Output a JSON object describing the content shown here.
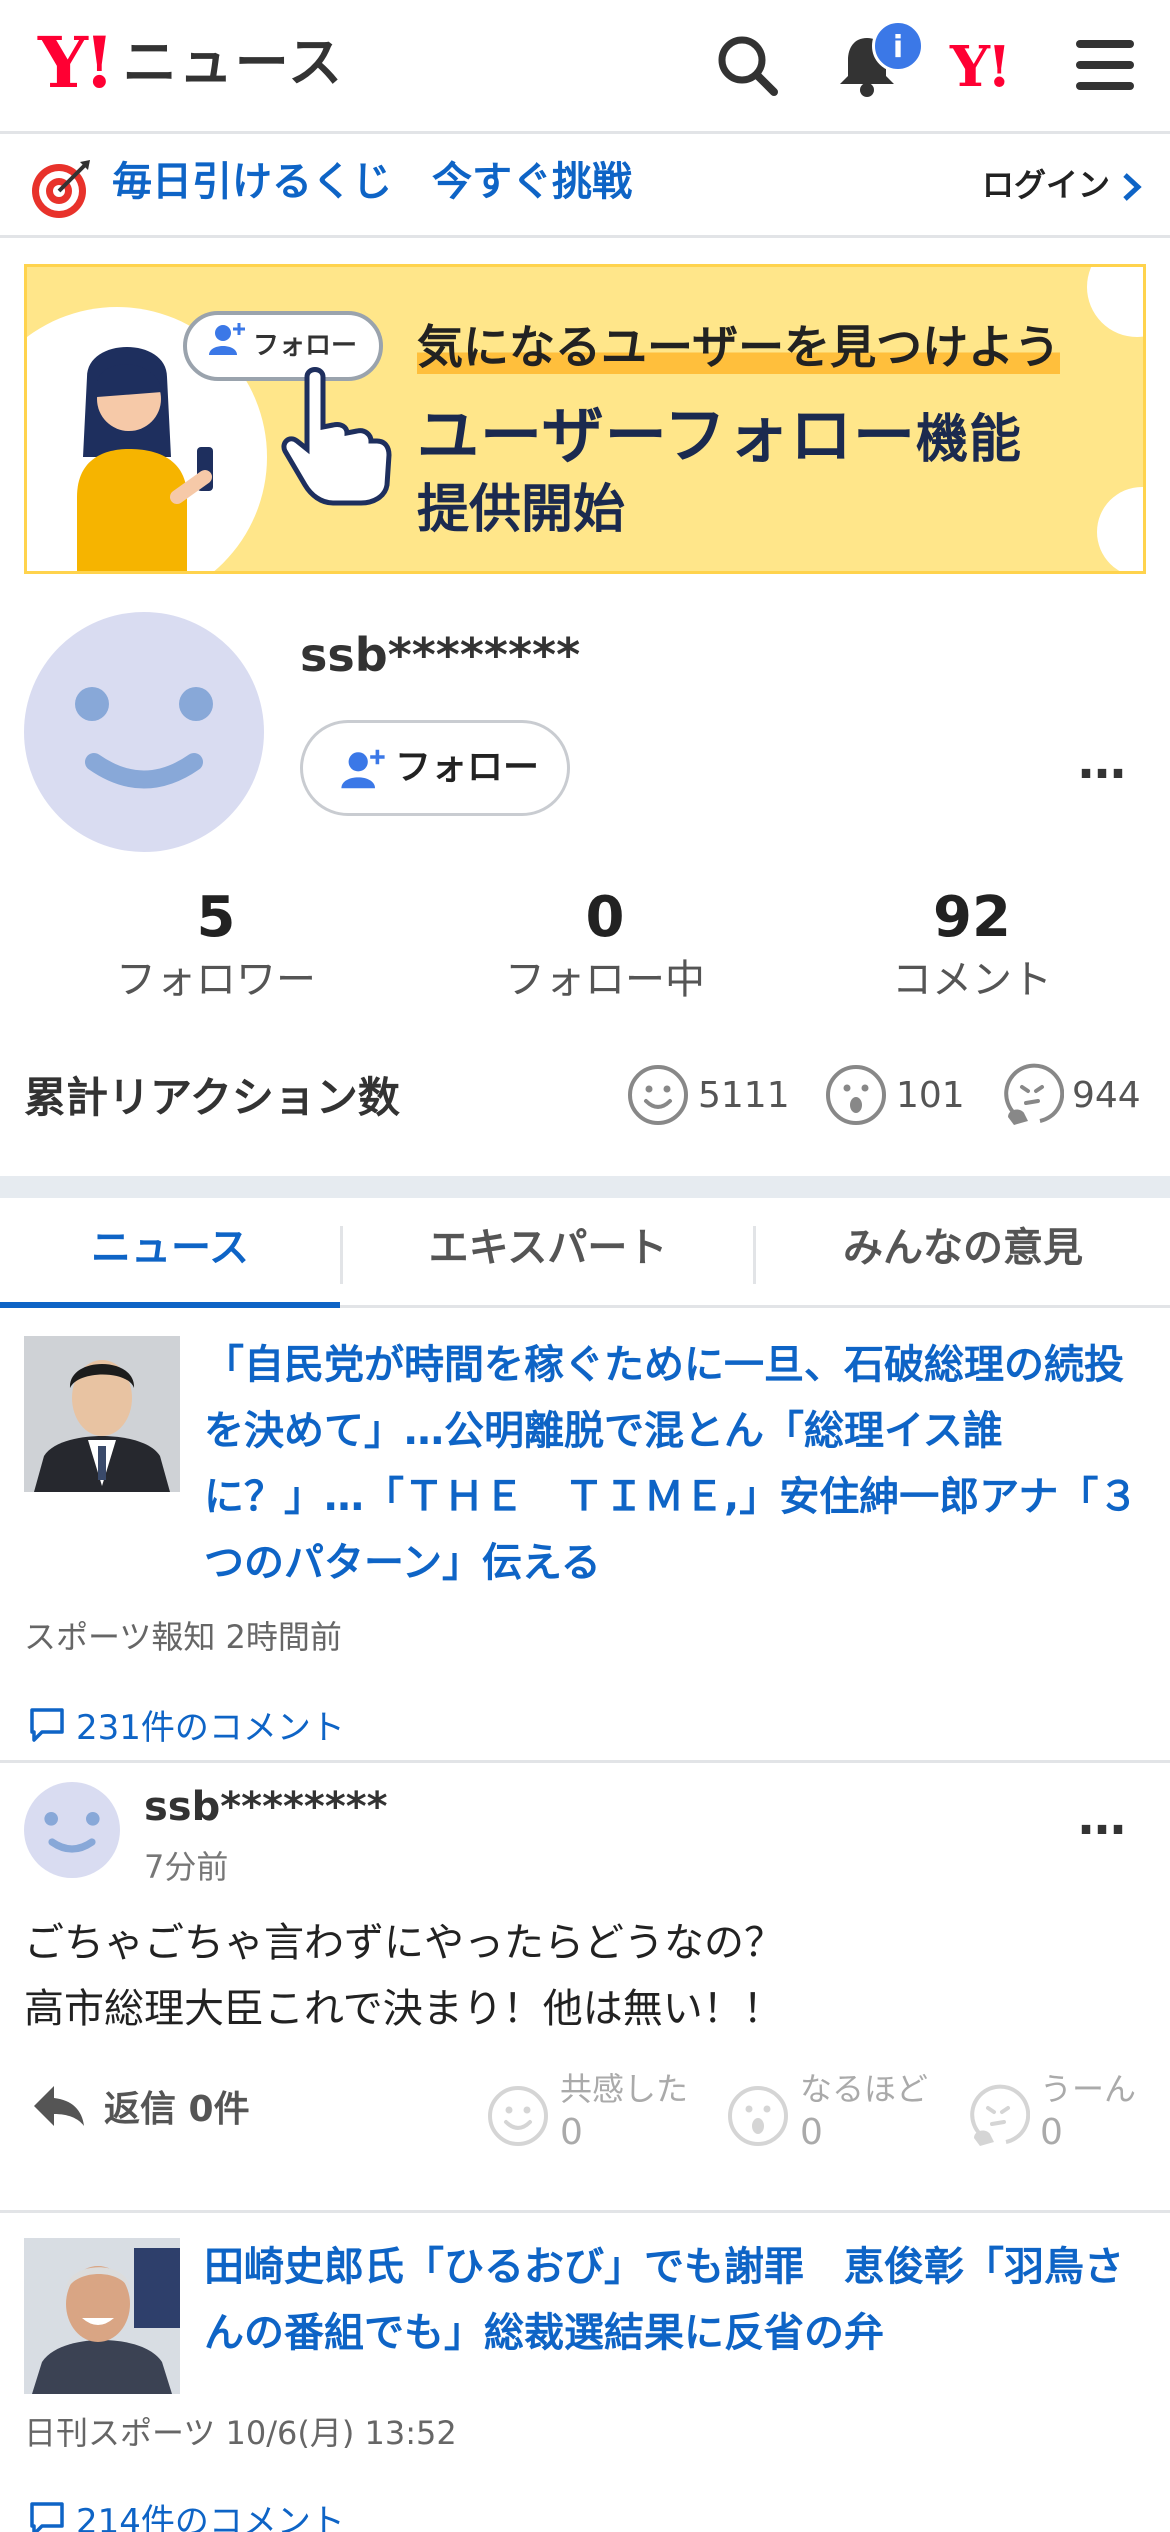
{
  "header": {
    "logo_y": "Y!",
    "logo_name": "ニュース",
    "notification_badge": "i",
    "ylogo": "Y!"
  },
  "lottery": {
    "text": "毎日引けるくじ　今すぐ挑戦",
    "login": "ログイン"
  },
  "banner": {
    "follow_chip": "フォロー",
    "line1": "気になるユーザーを見つけよう",
    "line2": "ユーザーフォロー",
    "line2_suffix": "機能",
    "line3": "提供開始"
  },
  "profile": {
    "username": "ssb********",
    "follow_button": "フォロー",
    "more": "…",
    "stats": [
      {
        "value": "5",
        "label": "フォロワー"
      },
      {
        "value": "0",
        "label": "フォロー中"
      },
      {
        "value": "92",
        "label": "コメント"
      }
    ],
    "reaction_title": "累計リアクション数",
    "reactions": [
      {
        "icon": "smile-icon",
        "value": "5111"
      },
      {
        "icon": "surprised-icon",
        "value": "101"
      },
      {
        "icon": "thinking-icon",
        "value": "944"
      }
    ]
  },
  "tabs": [
    {
      "label": "ニュース",
      "active": true
    },
    {
      "label": "エキスパート",
      "active": false
    },
    {
      "label": "みんなの意見",
      "active": false
    }
  ],
  "articles": [
    {
      "title": "「自民党が時間を稼ぐために一旦、石破総理の続投を決めて」…公明離脱で混とん「総理イス誰に？」…「ＴＨＥ　ＴＩＭＥ,」安住紳一郎アナ「３つのパターン」伝える",
      "meta": "スポーツ報知 2時間前",
      "comments": "231件のコメント"
    },
    {
      "title": "田崎史郎氏「ひるおび」でも謝罪　恵俊彰「羽鳥さんの番組でも」総裁選結果に反省の弁",
      "meta": "日刊スポーツ 10/6(月) 13:52",
      "comments": "214件のコメント"
    }
  ],
  "comment": {
    "username": "ssb********",
    "time": "7分前",
    "body_line1": "ごちゃごちゃ言わずにやったらどうなの？",
    "body_line2": "高市総理大臣これで決まり！他は無い！！",
    "reply": "返信 0件",
    "reactions": [
      {
        "label": "共感した",
        "value": "0"
      },
      {
        "label": "なるほど",
        "value": "0"
      },
      {
        "label": "うーん",
        "value": "0"
      }
    ]
  },
  "colors": {
    "accent": "#0e64c6",
    "brand_red": "#ff0033",
    "banner_bg": "#ffe68a"
  }
}
